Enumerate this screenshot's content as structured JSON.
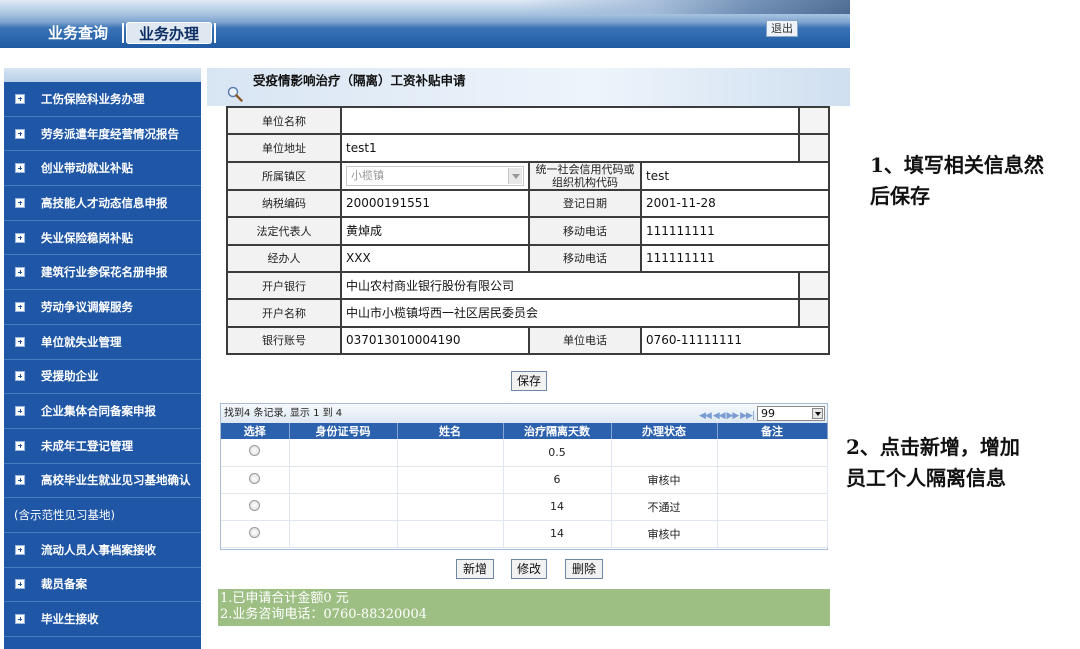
{
  "nav": {
    "tabs": [
      {
        "label": "业务查询",
        "active": false
      },
      {
        "label": "业务办理",
        "active": true
      }
    ],
    "logout_label": "退出"
  },
  "sidebar": {
    "items": [
      {
        "label": "工伤保险科业务办理"
      },
      {
        "label": "劳务派遣年度经营情况报告"
      },
      {
        "label": "创业带动就业补贴"
      },
      {
        "label": "高技能人才动态信息申报"
      },
      {
        "label": "失业保险稳岗补贴"
      },
      {
        "label": "建筑行业参保花名册申报"
      },
      {
        "label": "劳动争议调解服务"
      },
      {
        "label": "单位就失业管理"
      },
      {
        "label": "受援助企业"
      },
      {
        "label": "企业集体合同备案申报"
      },
      {
        "label": "未成年工登记管理"
      },
      {
        "label": "高校毕业生就业见习基地确认"
      },
      {
        "label": "(含示范性见习基地)",
        "note": true
      },
      {
        "label": "流动人员人事档案接收"
      },
      {
        "label": "裁员备案"
      },
      {
        "label": "毕业生接收"
      }
    ]
  },
  "page": {
    "title": "受疫情影响治疗（隔离）工资补贴申请"
  },
  "form": {
    "unit_name_label": "单位名称",
    "unit_name_value": "",
    "unit_address_label": "单位地址",
    "unit_address_value": "test1",
    "town_label": "所属镇区",
    "town_value": "小榄镇",
    "credit_code_label": "统一社会信用代码或组织机构代码",
    "credit_code_value": "test",
    "tax_no_label": "纳税编码",
    "tax_no_value": "20000191551",
    "reg_date_label": "登记日期",
    "reg_date_value": "2001-11-28",
    "legal_rep_label": "法定代表人",
    "legal_rep_value": "黄焯成",
    "mobile_label": "移动电话",
    "mobile_value": "111111111",
    "handler_label": "经办人",
    "handler_value": "XXX",
    "mobile2_label": "移动电话",
    "mobile2_value": "111111111",
    "bank_label": "开户银行",
    "bank_value": "中山农村商业银行股份有限公司",
    "account_name_label": "开户名称",
    "account_name_value": "中山市小榄镇埒西一社区居民委员会",
    "account_no_label": "银行账号",
    "account_no_value": "037013010004190",
    "unit_phone_label": "单位电话",
    "unit_phone_value": "0760-11111111",
    "save_label": "保存"
  },
  "grid": {
    "summary": "找到4 条记录, 显示 1 到 4",
    "pager_glyphs": "◀◀ ◀◀ ▶▶ ▶▶|",
    "page_size": "99",
    "columns": [
      "选择",
      "身份证号码",
      "姓名",
      "治疗隔离天数",
      "办理状态",
      "备注"
    ],
    "rows": [
      {
        "id": "",
        "name": "",
        "days": "0.5",
        "status": "",
        "remark": ""
      },
      {
        "id": "",
        "name": "",
        "days": "6",
        "status": "审核中",
        "remark": ""
      },
      {
        "id": "",
        "name": "",
        "days": "14",
        "status": "不通过",
        "remark": ""
      },
      {
        "id": "",
        "name": "",
        "days": "14",
        "status": "审核中",
        "remark": ""
      }
    ]
  },
  "actions": {
    "add_label": "新增",
    "edit_label": "修改",
    "delete_label": "删除"
  },
  "notes": {
    "line1": "1.已申请合计金额0 元",
    "line2": "2.业务咨询电话：0760-88320004"
  },
  "instructions": {
    "step1_line1": "1、填写相关信息然",
    "step1_line2": "后保存",
    "step2_line1": "2、点击新增，增加",
    "step2_line2": "员工个人隔离信息"
  },
  "colors": {
    "sidebar_bg": "#1f57a6",
    "grid_header_bg": "#2b61ad",
    "note_bg": "#9ebf84"
  }
}
